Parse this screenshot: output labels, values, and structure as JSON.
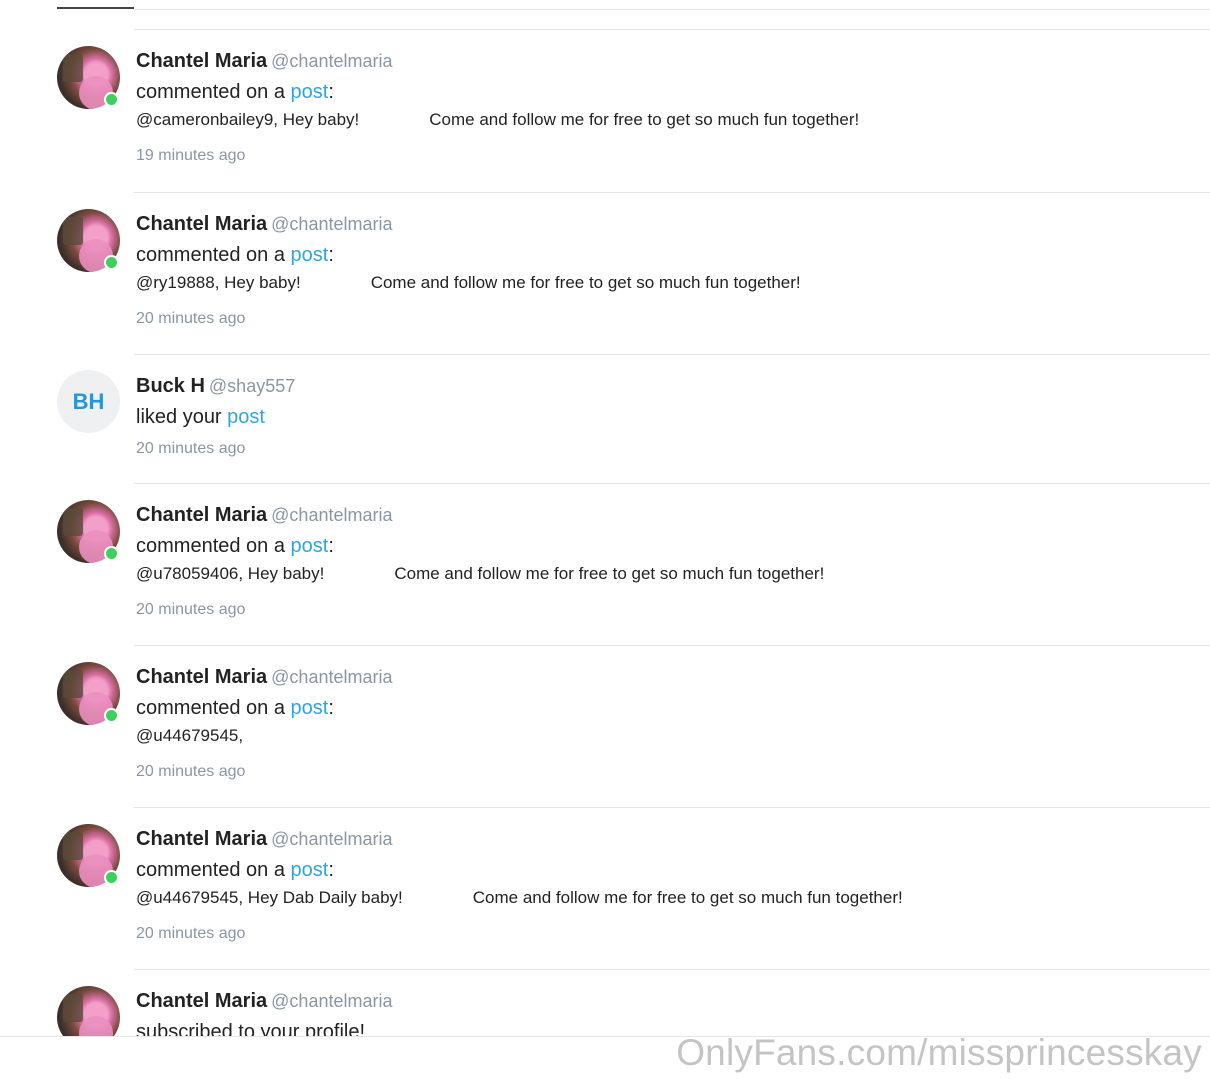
{
  "notifications": [
    {
      "avatar_type": "photo",
      "online": true,
      "name": "Chantel Maria",
      "handle": "@chantelmaria",
      "action": "commented on a ",
      "link": "post",
      "action_suffix": ":",
      "comment_mention": "@cameronbailey9, Hey baby!",
      "comment_body": "Come and follow me for free to get so much fun together!",
      "time": "19 minutes ago"
    },
    {
      "avatar_type": "photo",
      "online": true,
      "name": "Chantel Maria",
      "handle": "@chantelmaria",
      "action": "commented on a ",
      "link": "post",
      "action_suffix": ":",
      "comment_mention": "@ry19888, Hey baby!",
      "comment_body": "Come and follow me for free to get so much fun together!",
      "time": "20 minutes ago"
    },
    {
      "avatar_type": "initials",
      "initials": "BH",
      "online": false,
      "name": "Buck H",
      "handle": "@shay557",
      "action": "liked your ",
      "link": "post",
      "action_suffix": "",
      "time": "20 minutes ago"
    },
    {
      "avatar_type": "photo",
      "online": true,
      "name": "Chantel Maria",
      "handle": "@chantelmaria",
      "action": "commented on a ",
      "link": "post",
      "action_suffix": ":",
      "comment_mention": "@u78059406, Hey baby!",
      "comment_body": "Come and follow me for free to get so much fun together!",
      "time": "20 minutes ago"
    },
    {
      "avatar_type": "photo",
      "online": true,
      "name": "Chantel Maria",
      "handle": "@chantelmaria",
      "action": "commented on a ",
      "link": "post",
      "action_suffix": ":",
      "comment_mention": "@u44679545,",
      "comment_body": "",
      "time": "20 minutes ago"
    },
    {
      "avatar_type": "photo",
      "online": true,
      "name": "Chantel Maria",
      "handle": "@chantelmaria",
      "action": "commented on a ",
      "link": "post",
      "action_suffix": ":",
      "comment_mention": "@u44679545, Hey Dab Daily baby!",
      "comment_body": "Come and follow me for free to get so much fun together!",
      "time": "20 minutes ago"
    },
    {
      "avatar_type": "photo",
      "online": false,
      "name": "Chantel Maria",
      "handle": "@chantelmaria",
      "action": "subscribed to your profile!",
      "link": "",
      "action_suffix": "",
      "time": ""
    }
  ],
  "watermark": "OnlyFans.com/missprincesskay",
  "colors": {
    "link": "#2da6e0",
    "muted": "#8a96a3",
    "online": "#3fcf5e"
  }
}
